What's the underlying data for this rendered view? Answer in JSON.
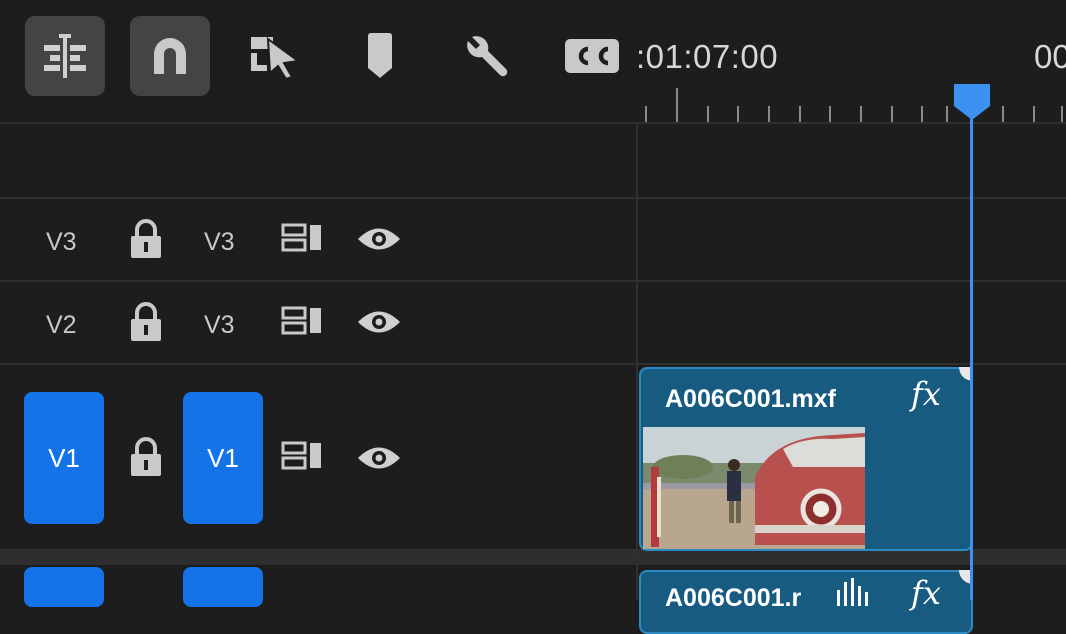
{
  "toolbar": {
    "tools": [
      {
        "name": "insert-overwrite-sequences-icon",
        "active": true
      },
      {
        "name": "snap-icon",
        "active": true
      },
      {
        "name": "linked-selection-icon",
        "active": false
      },
      {
        "name": "add-marker-icon",
        "active": false
      },
      {
        "name": "timeline-settings-icon",
        "active": false
      },
      {
        "name": "captions-icon",
        "active": false,
        "label": "CC"
      }
    ]
  },
  "ruler": {
    "timecode": ":01:07:00",
    "timecode_next": "00"
  },
  "tracks": [
    {
      "id": "v3",
      "source_label": "V3",
      "target_label": "V3",
      "source_active": false,
      "target_active": false
    },
    {
      "id": "v2",
      "source_label": "V2",
      "target_label": "V3",
      "source_active": false,
      "target_active": false
    },
    {
      "id": "v1",
      "source_label": "V1",
      "target_label": "V1",
      "source_active": true,
      "target_active": true
    }
  ],
  "clips": {
    "video": {
      "name": "A006C001.mxf",
      "fx": "fx"
    },
    "audio": {
      "name": "A006C001.r",
      "fx": "fx"
    }
  },
  "colors": {
    "accent": "#1473e6",
    "clip": "#175c80",
    "playhead": "#3d91f0",
    "background": "#1d1d1d"
  }
}
